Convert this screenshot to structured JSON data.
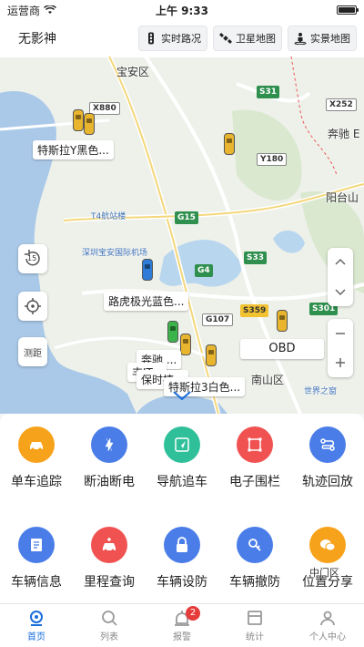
{
  "status_bar": {
    "carrier": "运营商",
    "time": "上午 9:33",
    "battery_level": 1.0
  },
  "header": {
    "title": "无影神",
    "buttons": [
      {
        "label": "实时路况",
        "icon": "traffic-light-icon"
      },
      {
        "label": "卫星地图",
        "icon": "satellite-icon"
      },
      {
        "label": "实景地图",
        "icon": "street-view-icon"
      }
    ]
  },
  "map": {
    "places": {
      "baoan": "宝安区",
      "benchi": "奔驰 E",
      "yangtai": "阳台山",
      "t4": "T4航站楼",
      "airport": "深圳宝安国际机场",
      "nanshan": "南山区",
      "window": "世界之窗",
      "park": "中门区"
    },
    "roads": {
      "x880": "X880",
      "s31": "S31",
      "x252": "X252",
      "y180": "Y180",
      "g15": "G15",
      "g4": "G4",
      "s33": "S33",
      "s359": "S359",
      "s301": "S301",
      "g107": "G107"
    },
    "vehicles": {
      "tesla_y": "特斯拉Y黑色...",
      "tiger": "路虎极光蓝色...",
      "tesla_3": "特斯拉3白色...",
      "benchi": "奔驰 ...",
      "baoshi": "保时捷...",
      "plate": "丰JT..."
    },
    "obd_label": "OBD",
    "controls": {
      "refresh_count": "15",
      "measure": "测距"
    }
  },
  "menu": {
    "items": [
      {
        "label": "单车追踪",
        "icon": "car-track-icon",
        "color": "#f7a21b"
      },
      {
        "label": "断油断电",
        "icon": "fuel-cut-icon",
        "color": "#4a7de8"
      },
      {
        "label": "导航追车",
        "icon": "navigation-icon",
        "color": "#2fc09a"
      },
      {
        "label": "电子围栏",
        "icon": "fence-icon",
        "color": "#f05252"
      },
      {
        "label": "轨迹回放",
        "icon": "route-playback-icon",
        "color": "#4a7de8"
      },
      {
        "label": "车辆信息",
        "icon": "vehicle-info-icon",
        "color": "#4a7de8"
      },
      {
        "label": "里程查询",
        "icon": "mileage-icon",
        "color": "#f05252"
      },
      {
        "label": "车辆设防",
        "icon": "lock-icon",
        "color": "#4a7de8"
      },
      {
        "label": "车辆撤防",
        "icon": "unlock-icon",
        "color": "#4a7de8"
      },
      {
        "label": "位置分享",
        "icon": "share-icon",
        "color": "#f7a21b"
      }
    ]
  },
  "tabbar": {
    "tabs": [
      {
        "label": "首页",
        "icon": "home-icon"
      },
      {
        "label": "列表",
        "icon": "search-icon"
      },
      {
        "label": "报警",
        "icon": "alarm-icon",
        "badge": "2"
      },
      {
        "label": "统计",
        "icon": "stats-icon"
      },
      {
        "label": "个人中心",
        "icon": "user-icon"
      }
    ],
    "active": "首页"
  },
  "colors": {
    "accent": "#1a6ddb",
    "sea": "#aac9e8",
    "road_green": "#2f8f4e"
  }
}
